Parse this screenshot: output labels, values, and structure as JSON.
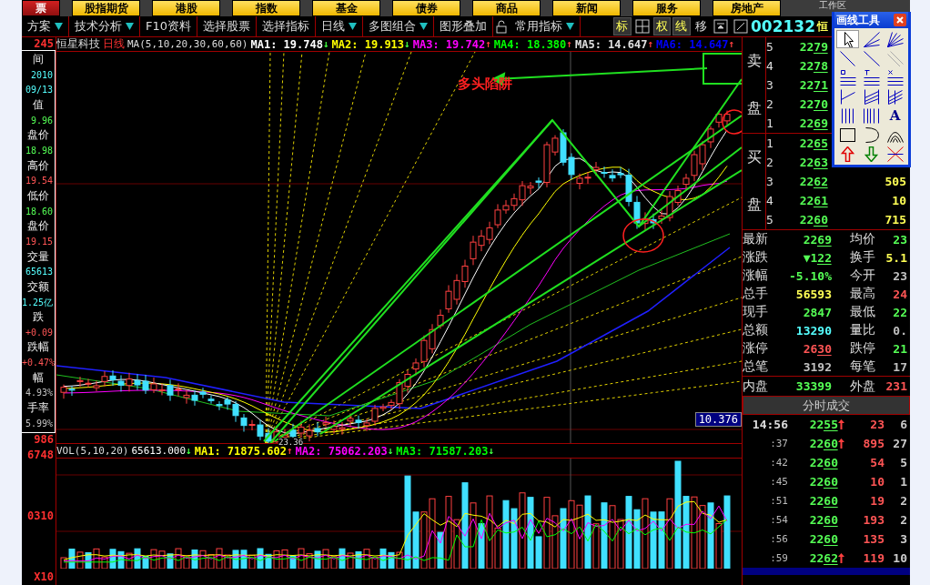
{
  "top_menu": [
    {
      "label": "票",
      "selected": true
    },
    {
      "label": "股指期货",
      "selected": false
    },
    {
      "label": "港股",
      "selected": false
    },
    {
      "label": "指数",
      "selected": false
    },
    {
      "label": "基金",
      "selected": false
    },
    {
      "label": "债券",
      "selected": false
    },
    {
      "label": "商品",
      "selected": false
    },
    {
      "label": "新闻",
      "selected": false
    },
    {
      "label": "服务",
      "selected": false
    },
    {
      "label": "房地产",
      "selected": false
    }
  ],
  "workspace": {
    "label": "工作区"
  },
  "toolbar": {
    "items": [
      {
        "label": "方案",
        "dropdown": true
      },
      {
        "label": "技术分析",
        "dropdown": true
      },
      {
        "label": "F10资料",
        "dropdown": false
      },
      {
        "label": "选择股票",
        "dropdown": false
      },
      {
        "label": "选择指标",
        "dropdown": false
      },
      {
        "label": "日线",
        "dropdown": true
      },
      {
        "label": "多图组合",
        "dropdown": true
      },
      {
        "label": "图形叠加",
        "dropdown": false
      }
    ],
    "indicator_menu": {
      "label": "常用指标",
      "dropdown": true
    },
    "toggles": [
      {
        "label": "标",
        "selected": true
      },
      {
        "label": "权",
        "selected": true
      },
      {
        "label": "线",
        "selected": true
      },
      {
        "label": "移",
        "selected": false
      }
    ],
    "stock_code": "002132",
    "stock_name": "恒"
  },
  "left_panel": {
    "top_value": "245",
    "items": [
      {
        "label": "间",
        "values": [
          "2010",
          "09/13"
        ],
        "color": "#55ffff"
      },
      {
        "label": "值",
        "values": [
          "9.96"
        ],
        "color": "#55ff55"
      },
      {
        "label": "盘价",
        "values": [
          "18.98"
        ],
        "color": "#55ff55"
      },
      {
        "label": "高价",
        "values": [
          "19.54"
        ],
        "color": "#ff5555"
      },
      {
        "label": "低价",
        "values": [
          "18.60"
        ],
        "color": "#55ff55"
      },
      {
        "label": "盘价",
        "values": [
          "19.15"
        ],
        "color": "#ff5555"
      },
      {
        "label": "交量",
        "values": [
          "65613"
        ],
        "color": "#55ffff"
      },
      {
        "label": "交额",
        "values": [
          "1.25亿"
        ],
        "color": "#55ffff"
      },
      {
        "label": "跌",
        "values": [
          "+0.09"
        ],
        "color": "#ff5555"
      },
      {
        "label": "跌幅",
        "values": [
          "+0.47%"
        ],
        "color": "#ff5555"
      },
      {
        "label": "幅",
        "values": [
          "4.93%"
        ],
        "color": "#c0c0c0"
      },
      {
        "label": "手率",
        "values": [
          "5.99%"
        ],
        "color": "#c0c0c0"
      }
    ],
    "price_axis_low": "986",
    "volume_axis": [
      "6748",
      "0310",
      "X10"
    ]
  },
  "chart": {
    "name": "恒星科技",
    "period": "日线",
    "ma_label": "MA(5,10,20,30,60,60)",
    "mas": [
      {
        "label": "MA1:",
        "value": "19.748",
        "arrow": "↓",
        "up": false,
        "color": "#ffffff"
      },
      {
        "label": "MA2:",
        "value": "19.913",
        "arrow": "↓",
        "up": false,
        "color": "#ffff00"
      },
      {
        "label": "MA3:",
        "value": "19.742",
        "arrow": "↑",
        "up": true,
        "color": "#ff00ff"
      },
      {
        "label": "MA4:",
        "value": "18.380",
        "arrow": "↑",
        "up": true,
        "color": "#00ff00"
      },
      {
        "label": "MA5:",
        "value": "14.647",
        "arrow": "↑",
        "up": true,
        "color": "#e0e0e0"
      },
      {
        "label": "MA6:",
        "value": "14.647",
        "arrow": "↑",
        "up": true,
        "color": "#0000ff"
      }
    ],
    "annotation": "多头陷阱",
    "price_tag": "10.376",
    "low_label": "23.36"
  },
  "volume": {
    "label": "VOL(5,10,20)",
    "value": "65613.000",
    "arrow": "↓",
    "up": false,
    "mas": [
      {
        "label": "MA1:",
        "value": "71875.602",
        "arrow": "↑",
        "up": true,
        "color": "#ffff00"
      },
      {
        "label": "MA2:",
        "value": "75062.203",
        "arrow": "↓",
        "up": false,
        "color": "#ff00ff"
      },
      {
        "label": "MA3:",
        "value": "71587.203",
        "arrow": "↓",
        "up": false,
        "color": "#00ff00"
      }
    ]
  },
  "order_book": {
    "sell": {
      "label_top": "卖",
      "label_bottom": "盘",
      "rows": [
        {
          "level": "5",
          "price": "2279"
        },
        {
          "level": "4",
          "price": "2278"
        },
        {
          "level": "3",
          "price": "2271"
        },
        {
          "level": "2",
          "price": "2270"
        },
        {
          "level": "1",
          "price": "2269"
        }
      ]
    },
    "buy": {
      "label_top": "买",
      "label_bottom": "盘",
      "rows": [
        {
          "level": "1",
          "price": "2265"
        },
        {
          "level": "2",
          "price": "2263"
        },
        {
          "level": "3",
          "price": "2262",
          "volume": "505"
        },
        {
          "level": "4",
          "price": "2261",
          "volume": "10"
        },
        {
          "level": "5",
          "price": "2260",
          "volume": "715"
        }
      ]
    }
  },
  "stats": [
    {
      "left": {
        "label": "最新",
        "value": "2269",
        "color": "#55ff55",
        "underline": true
      },
      "right": {
        "label": "均价",
        "value": "23",
        "color": "#55ff55"
      }
    },
    {
      "left": {
        "label": "涨跌",
        "value": "▼122",
        "color": "#55ff55",
        "underline": true
      },
      "right": {
        "label": "换手",
        "value": "5.1",
        "color": "#ffff55"
      }
    },
    {
      "left": {
        "label": "涨幅",
        "value": "-5.10%",
        "color": "#55ff55",
        "underline": false
      },
      "right": {
        "label": "今开",
        "value": "23",
        "color": "#c0c0c0"
      }
    },
    {
      "left": {
        "label": "总手",
        "value": "56593",
        "color": "#ffff55",
        "underline": false
      },
      "right": {
        "label": "最高",
        "value": "24",
        "color": "#ff5555"
      }
    },
    {
      "left": {
        "label": "现手",
        "value": "2847",
        "color": "#55ff55",
        "underline": false
      },
      "right": {
        "label": "最低",
        "value": "22",
        "color": "#55ff55"
      }
    },
    {
      "left": {
        "label": "总额",
        "value": "13290",
        "color": "#55ffff",
        "underline": false
      },
      "right": {
        "label": "量比",
        "value": "0.",
        "color": "#c0c0c0"
      }
    },
    {
      "left": {
        "label": "涨停",
        "value": "2630",
        "color": "#ff5555",
        "underline": true
      },
      "right": {
        "label": "跌停",
        "value": "21",
        "color": "#55ff55"
      }
    },
    {
      "left": {
        "label": "总笔",
        "value": "3192",
        "color": "#c0c0c0",
        "underline": false
      },
      "right": {
        "label": "每笔",
        "value": "17",
        "color": "#c0c0c0"
      }
    },
    {
      "left": {
        "label": "内盘",
        "value": "33399",
        "color": "#55ff55",
        "underline": false
      },
      "right": {
        "label": "外盘",
        "value": "231",
        "color": "#ff5555"
      }
    }
  ],
  "ticks": {
    "title": "分时成交",
    "rows": [
      {
        "time": "14:56",
        "price": "2255",
        "up": true,
        "volume": "23",
        "column_4": "6"
      },
      {
        "time": ":37",
        "price": "2260",
        "up": true,
        "volume": "895",
        "column_4": "27"
      },
      {
        "time": ":42",
        "price": "2260",
        "up": false,
        "volume": "54",
        "column_4": "5"
      },
      {
        "time": ":45",
        "price": "2260",
        "up": false,
        "volume": "10",
        "column_4": "1"
      },
      {
        "time": ":51",
        "price": "2260",
        "up": false,
        "volume": "19",
        "column_4": "2"
      },
      {
        "time": ":54",
        "price": "2260",
        "up": false,
        "volume": "193",
        "column_4": "2"
      },
      {
        "time": ":56",
        "price": "2260",
        "up": false,
        "volume": "135",
        "column_4": "3"
      },
      {
        "time": ":59",
        "price": "2262",
        "up": true,
        "volume": "119",
        "column_4": "10"
      }
    ]
  },
  "drawing_tools": {
    "title": "画线工具",
    "text_tool": "A"
  }
}
